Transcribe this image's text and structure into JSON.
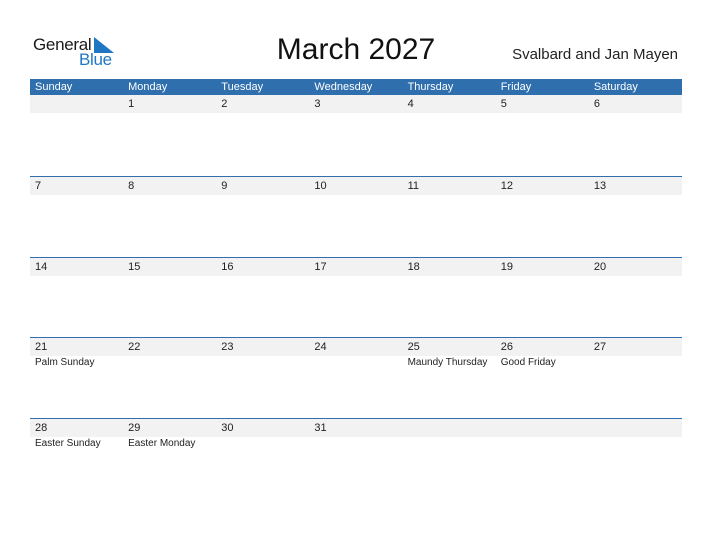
{
  "logo": {
    "text_general": "General",
    "text_blue": "Blue",
    "accent": "#1f77c4"
  },
  "title": "March 2027",
  "region": "Svalbard and Jan Mayen",
  "colors": {
    "header_bg": "#2f6fad",
    "date_strip_bg": "#f2f2f2"
  },
  "weekdays": [
    "Sunday",
    "Monday",
    "Tuesday",
    "Wednesday",
    "Thursday",
    "Friday",
    "Saturday"
  ],
  "weeks": [
    {
      "days": [
        "",
        "1",
        "2",
        "3",
        "4",
        "5",
        "6"
      ],
      "events": [
        "",
        "",
        "",
        "",
        "",
        "",
        ""
      ]
    },
    {
      "days": [
        "7",
        "8",
        "9",
        "10",
        "11",
        "12",
        "13"
      ],
      "events": [
        "",
        "",
        "",
        "",
        "",
        "",
        ""
      ]
    },
    {
      "days": [
        "14",
        "15",
        "16",
        "17",
        "18",
        "19",
        "20"
      ],
      "events": [
        "",
        "",
        "",
        "",
        "",
        "",
        ""
      ]
    },
    {
      "days": [
        "21",
        "22",
        "23",
        "24",
        "25",
        "26",
        "27"
      ],
      "events": [
        "Palm Sunday",
        "",
        "",
        "",
        "Maundy Thursday",
        "Good Friday",
        ""
      ]
    },
    {
      "days": [
        "28",
        "29",
        "30",
        "31",
        "",
        "",
        ""
      ],
      "events": [
        "Easter Sunday",
        "Easter Monday",
        "",
        "",
        "",
        "",
        ""
      ]
    }
  ]
}
